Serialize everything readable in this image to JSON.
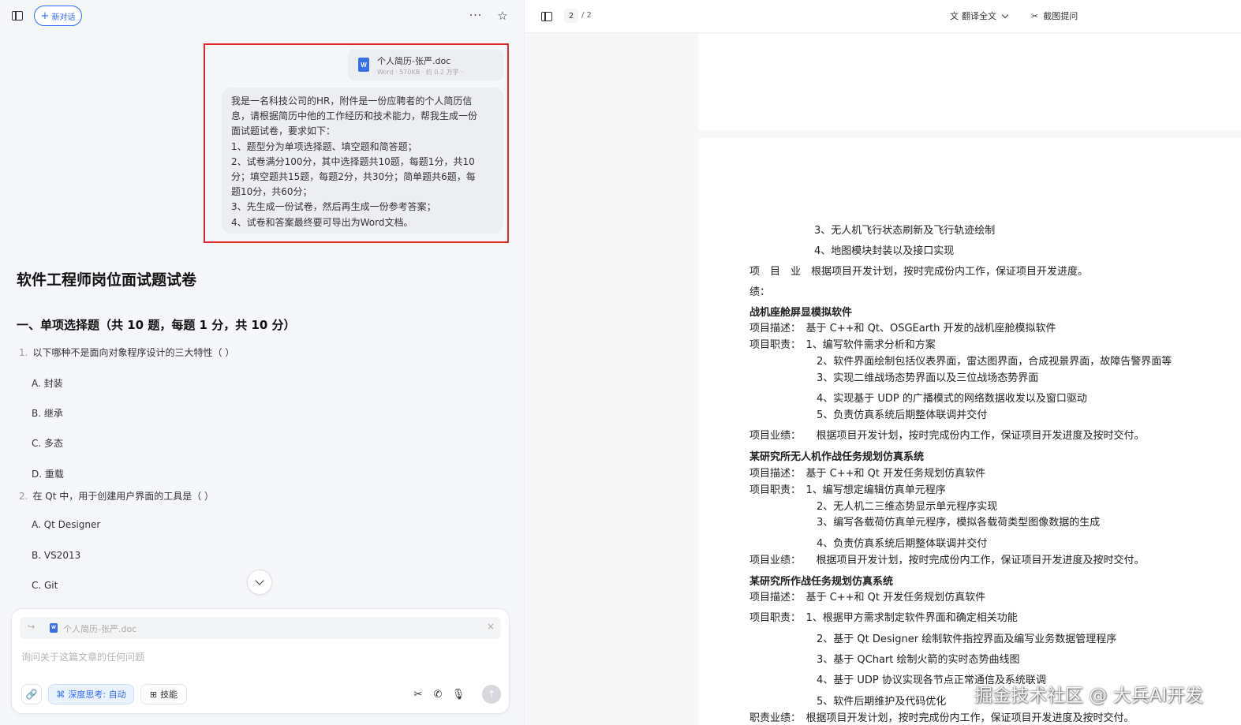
{
  "chat": {
    "new_chat_label": "新对话",
    "more_glyph": "···",
    "star_glyph": "☆",
    "attachment": {
      "name": "个人简历-张严.doc",
      "meta": "Word · 570KB · 约 0.2 万字 ·",
      "icon_letter": "W"
    },
    "user_message": [
      "我是一名科技公司的HR，附件是一份应聘者的个人简历信",
      "息，请根据简历中他的工作经历和技术能力，帮我生成一份",
      "面试题试卷，要求如下：",
      "1、题型分为单项选择题、填空题和简答题；",
      "2、试卷满分100分，其中选择题共10题，每题1分，共10",
      "分；填空题共15题，每题2分，共30分；简单题共6题，每",
      "题10分，共60分；",
      "3、先生成一份试卷，然后再生成一份参考答案；",
      "4、试卷和答案最终要可导出为Word文档。"
    ],
    "doc_title": "软件工程师岗位面试题试卷",
    "section_title": "一、单项选择题（共 10 题，每题 1 分，共 10 分）",
    "questions": [
      {
        "num": "1.",
        "text": "以下哪种不是面向对象程序设计的三大特性（ ）",
        "options": [
          "A. 封装",
          "B. 继承",
          "C. 多态",
          "D. 重载"
        ]
      },
      {
        "num": "2.",
        "text": "在 Qt 中，用于创建用户界面的工具是（ ）",
        "options": [
          "A. Qt Designer",
          "B. VS2013",
          "C. Git"
        ]
      }
    ],
    "input": {
      "attachment_name": "个人简历-张严.doc",
      "placeholder": "询问关于这篇文章的任何问题",
      "deep_think_label": "深度思考: 自动",
      "skills_label": "技能",
      "close_glyph": "×",
      "reply_glyph": "↪",
      "paperclip_glyph": "🔗",
      "scissors_glyph": "✂",
      "phone_glyph": "✆",
      "mic_glyph": "🎙",
      "send_glyph": "↑"
    }
  },
  "viewer": {
    "page_current": "2",
    "page_total": "/ 2",
    "translate_label": "翻译全文",
    "screenshot_label": "截图提问",
    "lines": [
      {
        "text": "3、无人机飞行状态刷新及飞行轨迹绘制",
        "bold": false
      },
      {
        "text": "4、地图模块封装以及接口实现",
        "bold": false
      },
      {
        "text": "项　目　业　根据项目开发计划，按时完成份内工作，保证项目开发进度。",
        "bold": false
      },
      {
        "text": "绩：",
        "bold": false
      },
      {
        "text": "战机座舱屏显模拟软件",
        "bold": true
      },
      {
        "text": "项目描述：　基于 C++和 Qt、OSGEarth 开发的战机座舱模拟软件",
        "bold": false
      },
      {
        "text": "项目职责：　1、编写软件需求分析和方案",
        "bold": false
      },
      {
        "text": "2、软件界面绘制包括仪表界面，雷达图界面，合成视景界面，故障告警界面等",
        "bold": false
      },
      {
        "text": "3、实现二维战场态势界面以及三位战场态势界面",
        "bold": false
      },
      {
        "text": "4、实现基于 UDP 的广播模式的网络数据收发以及窗口驱动",
        "bold": false
      },
      {
        "text": "5、负责仿真系统后期整体联调并交付",
        "bold": false
      },
      {
        "text": "项目业绩：　　根据项目开发计划，按时完成份内工作，保证项目开发进度及按时交付。",
        "bold": false
      },
      {
        "text": "某研究所无人机作战任务规划仿真系统",
        "bold": true
      },
      {
        "text": "项目描述：　基于 C++和 Qt 开发任务规划仿真软件",
        "bold": false
      },
      {
        "text": "项目职责：　1、编写想定编辑仿真单元程序",
        "bold": false
      },
      {
        "text": "2、无人机二三维态势显示单元程序实现",
        "bold": false
      },
      {
        "text": "3、编写各载荷仿真单元程序，模拟各载荷类型图像数据的生成",
        "bold": false
      },
      {
        "text": "4、负责仿真系统后期整体联调并交付",
        "bold": false
      },
      {
        "text": "项目业绩：　　根据项目开发计划，按时完成份内工作，保证项目开发进度及按时交付。",
        "bold": false
      },
      {
        "text": "某研究所作战任务规划仿真系统",
        "bold": true
      },
      {
        "text": "项目描述：　基于 C++和 Qt 开发任务规划仿真软件",
        "bold": false
      },
      {
        "text": "项目职责：　1、根据甲方需求制定软件界面和确定相关功能",
        "bold": false
      },
      {
        "text": "2、基于 Qt Designer 绘制软件指控界面及编写业务数据管理程序",
        "bold": false
      },
      {
        "text": "3、基于 QChart 绘制火箭的实时态势曲线图",
        "bold": false
      },
      {
        "text": "4、基于 UDP 协议实现各节点正常通信及系统联调",
        "bold": false
      },
      {
        "text": "5、软件后期维护及代码优化",
        "bold": false
      },
      {
        "text": "职责业绩：　根据项目开发计划，按时完成份内工作，保证项目开发进度及按时交付。",
        "bold": false
      }
    ]
  },
  "watermark": "掘金技术社区 @ 大兵AI开发"
}
